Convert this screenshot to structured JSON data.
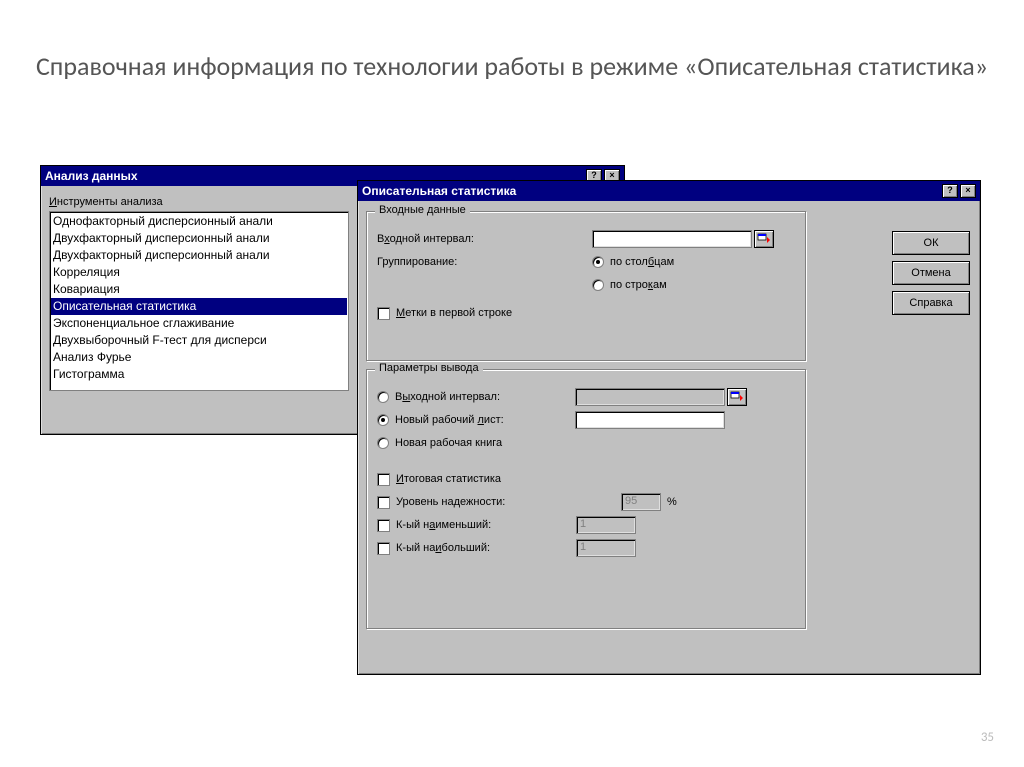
{
  "slide": {
    "title": "Справочная информация по технологии работы в режиме «Описательная статистика»",
    "page_number": "35"
  },
  "analysis_dialog": {
    "title": "Анализ данных",
    "tools_label": "Инструменты анализа",
    "items": [
      "Однофакторный дисперсионный анали",
      "Двухфакторный дисперсионный анали",
      "Двухфакторный дисперсионный анали",
      "Корреляция",
      "Ковариация",
      "Описательная статистика",
      "Экспоненциальное сглаживание",
      "Двухвыборочный F-тест для дисперси",
      "Анализ Фурье",
      "Гистограмма"
    ],
    "selected_index": 5
  },
  "desc_dialog": {
    "title": "Описательная статистика",
    "buttons": {
      "ok": "ОК",
      "cancel": "Отмена",
      "help": "Справка"
    },
    "input": {
      "legend": "Входные данные",
      "range_label_pre": "В",
      "range_label_u": "х",
      "range_label_post": "одной интервал:",
      "range_value": "",
      "group_label": "Группирование:",
      "by_columns_pre": "по стол",
      "by_columns_u": "б",
      "by_columns_post": "цам",
      "by_rows_pre": "по стро",
      "by_rows_u": "к",
      "by_rows_post": "ам",
      "labels_u": "М",
      "labels_post": "етки в первой строке"
    },
    "output": {
      "legend": "Параметры вывода",
      "out_range_pre": "В",
      "out_range_u": "ы",
      "out_range_post": "ходной интервал:",
      "new_sheet_pre": "Новый рабочий ",
      "new_sheet_u": "л",
      "new_sheet_post": "ист:",
      "new_book": "Новая рабочая книга",
      "summary_u": "И",
      "summary_post": "тоговая статистика",
      "confidence": "Уровень надежности:",
      "confidence_value": "95",
      "confidence_unit": "%",
      "kth_small_pre": "К-ый н",
      "kth_small_u": "а",
      "kth_small_post": "именьший:",
      "kth_small_value": "1",
      "kth_large_pre": "К-ый на",
      "kth_large_u": "и",
      "kth_large_post": "больший:",
      "kth_large_value": "1"
    }
  }
}
